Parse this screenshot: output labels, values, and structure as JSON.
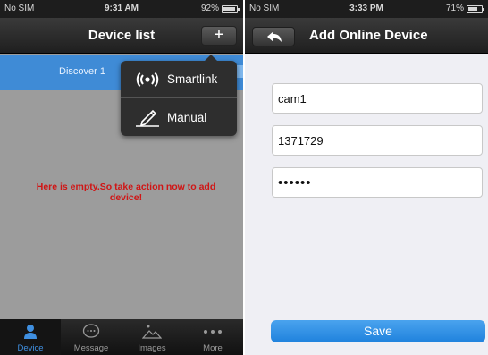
{
  "left_screen": {
    "status": {
      "carrier": "No SIM",
      "time": "9:31 AM",
      "battery": "92%",
      "battery_level": 0.92
    },
    "nav": {
      "title": "Device list",
      "add_label": "+"
    },
    "discover": {
      "text": "Discover 1"
    },
    "popup": {
      "items": [
        {
          "label": "Smartlink",
          "icon": "wifi-broadcast-icon"
        },
        {
          "label": "Manual",
          "icon": "pencil-icon"
        }
      ]
    },
    "empty_message": "Here is empty.So take action now to add device!",
    "tabs": [
      {
        "label": "Device",
        "icon": "person-icon",
        "active": true
      },
      {
        "label": "Message",
        "icon": "chat-icon",
        "active": false
      },
      {
        "label": "Images",
        "icon": "image-icon",
        "active": false
      },
      {
        "label": "More",
        "icon": "more-icon",
        "active": false
      }
    ]
  },
  "right_screen": {
    "status": {
      "carrier": "No SIM",
      "time": "3:33 PM",
      "battery": "71%",
      "battery_level": 0.71
    },
    "nav": {
      "title": "Add Online Device"
    },
    "form": {
      "name_value": "cam1",
      "id_value": "1371729",
      "password_value": "••••••"
    },
    "save_label": "Save"
  },
  "colors": {
    "accent_blue": "#3f8bd6",
    "error_red": "#d01515",
    "nav_dark": "#1f1f1f"
  }
}
